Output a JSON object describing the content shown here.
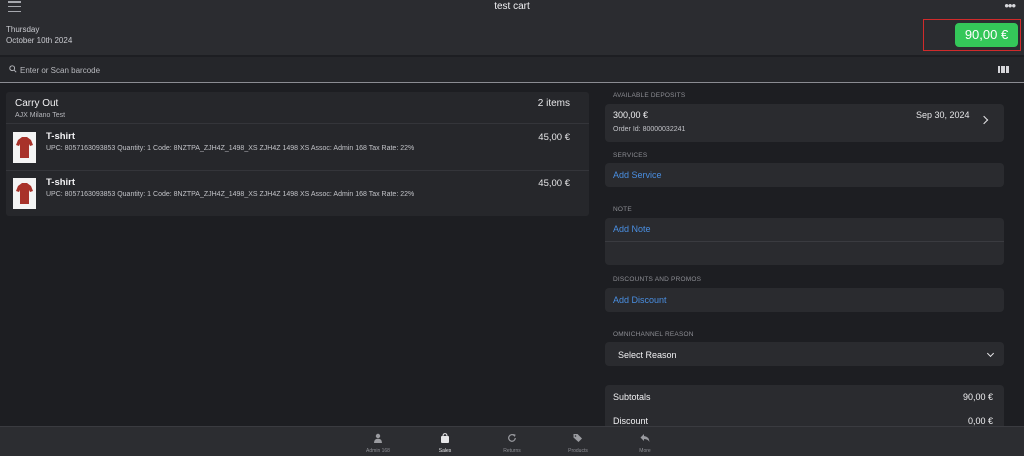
{
  "header": {
    "title": "test cart",
    "day": "Thursday",
    "date": "October 10th 2024",
    "total": "90,00 €"
  },
  "search": {
    "placeholder": "Enter or Scan barcode"
  },
  "cart": {
    "type": "Carry Out",
    "store": "AJX Milano Test",
    "count": "2 items",
    "items": [
      {
        "name": "T-shirt",
        "details": "UPC: 8057163093853 Quantity: 1 Code: 8NZTPA_ZJH4Z_1498_XS ZJH4Z 1498 XS Assoc: Admin 168 Tax Rate: 22%",
        "price": "45,00 €"
      },
      {
        "name": "T-shirt",
        "details": "UPC: 8057163093853 Quantity: 1 Code: 8NZTPA_ZJH4Z_1498_XS ZJH4Z 1498 XS Assoc: Admin 168 Tax Rate: 22%",
        "price": "45,00 €"
      }
    ]
  },
  "side": {
    "deposits_label": "AVAILABLE DEPOSITS",
    "deposit": {
      "amount": "300,00 €",
      "order_id": "Order Id: 80000032241",
      "date": "Sep 30, 2024"
    },
    "services_label": "SERVICES",
    "add_service": "Add Service",
    "note_label": "NOTE",
    "add_note": "Add Note",
    "discounts_label": "DISCOUNTS AND PROMOS",
    "add_discount": "Add Discount",
    "reason_label": "OMNICHANNEL REASON",
    "select_reason": "Select Reason",
    "totals": [
      {
        "label": "Subtotals",
        "value": "90,00 €"
      },
      {
        "label": "Discount",
        "value": "0,00 €"
      }
    ]
  },
  "tabs": [
    {
      "label": "Admin 168",
      "icon": "person-icon",
      "active": false
    },
    {
      "label": "Sales",
      "icon": "shopping-bag-icon",
      "active": true
    },
    {
      "label": "Returns",
      "icon": "refresh-icon",
      "active": false
    },
    {
      "label": "Products",
      "icon": "tags-icon",
      "active": false
    },
    {
      "label": "More",
      "icon": "reply-arrow-icon",
      "active": false
    }
  ],
  "colors": {
    "accent_green": "#34c759",
    "link_blue": "#4a8fe2",
    "highlight_red": "#d12b2b",
    "background": "#1d1e22"
  }
}
